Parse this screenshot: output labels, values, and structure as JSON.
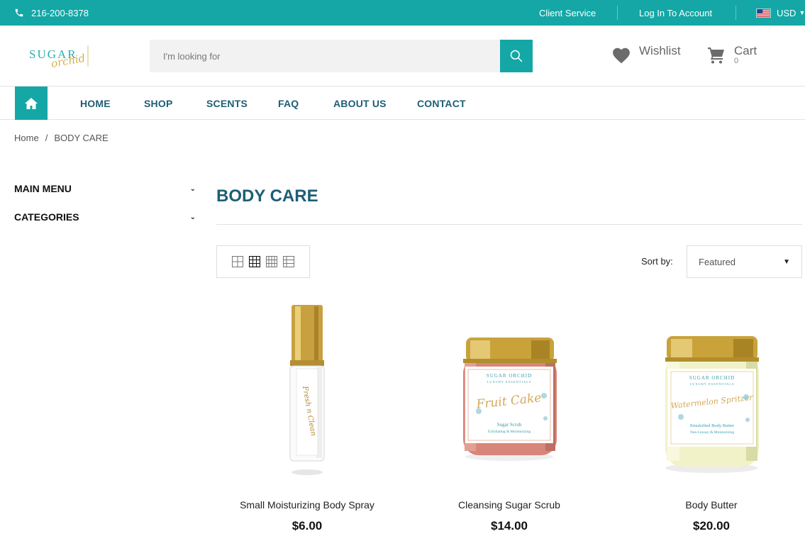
{
  "topbar": {
    "phone": "216-200-8378",
    "client_service": "Client Service",
    "login": "Log In To Account",
    "currency": "USD"
  },
  "header": {
    "logo_text": "SUGAR orchid",
    "search_placeholder": "I'm looking for",
    "wishlist_label": "Wishlist",
    "cart_label": "Cart",
    "cart_count": "0"
  },
  "nav": {
    "items": [
      "HOME",
      "SHOP",
      "SCENTS",
      "FAQ",
      "ABOUT US",
      "CONTACT"
    ]
  },
  "breadcrumb": {
    "home": "Home",
    "separator": "/",
    "current": "BODY CARE"
  },
  "sidebar": {
    "items": [
      "MAIN MENU",
      "CATEGORIES"
    ]
  },
  "main": {
    "title": "BODY CARE",
    "sort_label": "Sort by:",
    "sort_value": "Featured"
  },
  "products": [
    {
      "name": "Small Moisturizing Body Spray",
      "price": "$6.00",
      "label_text": "Fresh n Clean"
    },
    {
      "name": "Cleansing Sugar Scrub",
      "price": "$14.00",
      "brand": "SUGAR ORCHID",
      "sub": "LUXURY ESSENTIALS",
      "script": "Fruit Cake",
      "type": "Sugar Scrub",
      "desc": "Exfoliating & Moisturizing"
    },
    {
      "name": "Body Butter",
      "price": "$20.00",
      "brand": "SUGAR ORCHID",
      "sub": "LUXURY ESSENTIALS",
      "script": "Watermelon Spritzer",
      "type": "Emulsified Body Butter",
      "desc": "Non-Greasy & Moisturizing"
    }
  ],
  "colors": {
    "brand_teal": "#14a7a6",
    "nav_text": "#1e5e75",
    "gold": "#c9a23a"
  }
}
